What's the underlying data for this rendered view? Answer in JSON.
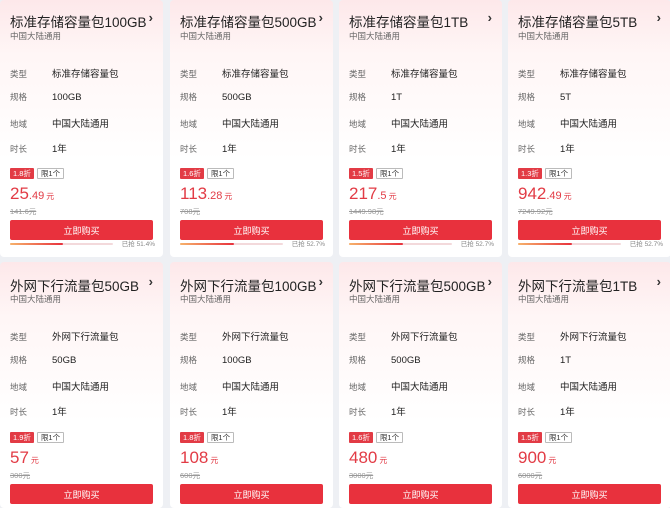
{
  "spec_labels": {
    "type": "类型",
    "size": "规格",
    "region": "地域",
    "duration": "时长"
  },
  "buy_label": "立即购买",
  "limit_label": "限1个",
  "unit": "元",
  "sold_prefix": "已抢",
  "cards": [
    {
      "title": "标准存储容量包100GB",
      "subtitle": "中国大陆通用",
      "type": "标准存储容量包",
      "size": "100GB",
      "region": "中国大陆通用",
      "duration": "1年",
      "discount": "1.8折",
      "price_int": "25",
      "price_dec": ".49",
      "orig": "141.6元",
      "sold_pct": "51.4%",
      "sold_frac": 0.514
    },
    {
      "title": "标准存储容量包500GB",
      "subtitle": "中国大陆通用",
      "type": "标准存储容量包",
      "size": "500GB",
      "region": "中国大陆通用",
      "duration": "1年",
      "discount": "1.6折",
      "price_int": "113",
      "price_dec": ".28",
      "orig": "708元",
      "sold_pct": "52.7%",
      "sold_frac": 0.527
    },
    {
      "title": "标准存储容量包1TB",
      "subtitle": "中国大陆通用",
      "type": "标准存储容量包",
      "size": "1T",
      "region": "中国大陆通用",
      "duration": "1年",
      "discount": "1.5折",
      "price_int": "217",
      "price_dec": ".5",
      "orig": "1449.98元",
      "sold_pct": "52.7%",
      "sold_frac": 0.527
    },
    {
      "title": "标准存储容量包5TB",
      "subtitle": "中国大陆通用",
      "type": "标准存储容量包",
      "size": "5T",
      "region": "中国大陆通用",
      "duration": "1年",
      "discount": "1.3折",
      "price_int": "942",
      "price_dec": ".49",
      "orig": "7249.92元",
      "sold_pct": "52.7%",
      "sold_frac": 0.527
    },
    {
      "title": "外网下行流量包50GB",
      "subtitle": "中国大陆通用",
      "type": "外网下行流量包",
      "size": "50GB",
      "region": "中国大陆通用",
      "duration": "1年",
      "discount": "1.9折",
      "price_int": "57",
      "price_dec": "",
      "orig": "300元"
    },
    {
      "title": "外网下行流量包100GB",
      "subtitle": "中国大陆通用",
      "type": "外网下行流量包",
      "size": "100GB",
      "region": "中国大陆通用",
      "duration": "1年",
      "discount": "1.8折",
      "price_int": "108",
      "price_dec": "",
      "orig": "600元"
    },
    {
      "title": "外网下行流量包500GB",
      "subtitle": "中国大陆通用",
      "type": "外网下行流量包",
      "size": "500GB",
      "region": "中国大陆通用",
      "duration": "1年",
      "discount": "1.6折",
      "price_int": "480",
      "price_dec": "",
      "orig": "3000元"
    },
    {
      "title": "外网下行流量包1TB",
      "subtitle": "中国大陆通用",
      "type": "外网下行流量包",
      "size": "1T",
      "region": "中国大陆通用",
      "duration": "1年",
      "discount": "1.5折",
      "price_int": "900",
      "price_dec": "",
      "orig": "6000元"
    }
  ]
}
